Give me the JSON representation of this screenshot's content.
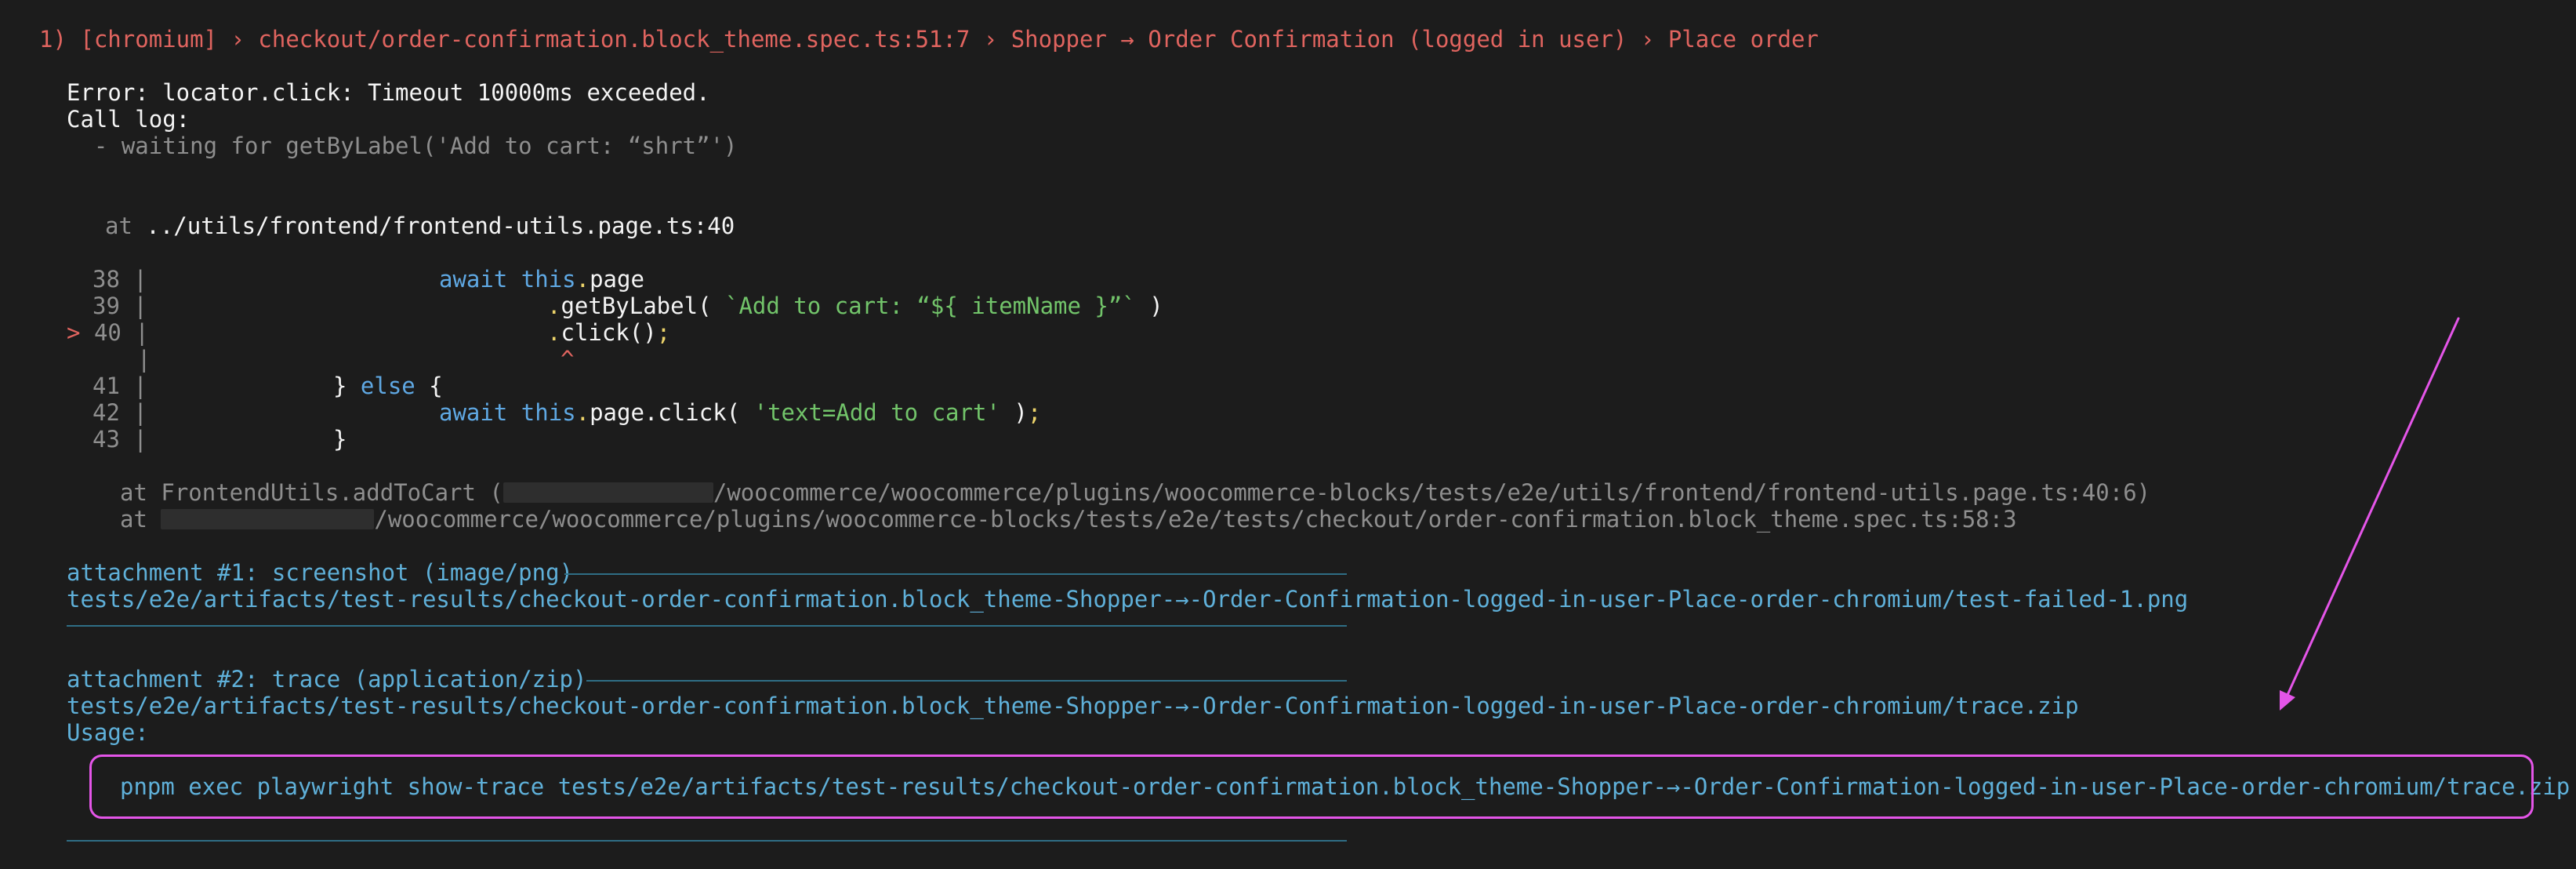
{
  "header": {
    "number": "1)",
    "project": "[chromium]",
    "sep1": "›",
    "file": "checkout/order-confirmation.block_theme.spec.ts:51:7",
    "sep2": "›",
    "suite": "Shopper → Order Confirmation (logged in user)",
    "sep3": "›",
    "test": "Place order"
  },
  "error": {
    "message": "Error: locator.click: Timeout 10000ms exceeded.",
    "call_log_label": "Call log:",
    "call_log_entry": "  - waiting for getByLabel('Add to cart: “shrt”')"
  },
  "location": {
    "prefix": "at ",
    "path": "../utils/frontend/frontend-utils.page.ts:40"
  },
  "code": {
    "marker": ">",
    "lines": [
      {
        "num": "38",
        "pipe": "|"
      },
      {
        "num": "39",
        "pipe": "|"
      },
      {
        "num": "40",
        "pipe": "|"
      },
      {
        "num": "",
        "pipe": "|"
      },
      {
        "num": "41",
        "pipe": "|"
      },
      {
        "num": "42",
        "pipe": "|"
      },
      {
        "num": "43",
        "pipe": "|"
      }
    ],
    "await": "await",
    "this": "this",
    "dot": ".",
    "page": "page",
    "getByLabel": "getByLabel(",
    "template": "`Add to cart: “${ itemName }”`",
    "close_paren": " )",
    "click_call": "click()",
    "semicolon": ";",
    "caret": "^",
    "close_brace_else": "} ",
    "else": "else",
    "open_brace": " {",
    "page_click": "page.click( ",
    "text_arg": "'text=Add to cart'",
    "end_call": " );",
    "close_brace": "}"
  },
  "stack": {
    "line1_prefix": "at FrontendUtils.addToCart (",
    "line1_suffix": "/woocommerce/woocommerce/plugins/woocommerce-blocks/tests/e2e/utils/frontend/frontend-utils.page.ts:40:6)",
    "line2_prefix": "at ",
    "line2_suffix": "/woocommerce/woocommerce/plugins/woocommerce-blocks/tests/e2e/tests/checkout/order-confirmation.block_theme.spec.ts:58:3"
  },
  "attachment1": {
    "title": "attachment #1: screenshot (image/png) ",
    "path": "tests/e2e/artifacts/test-results/checkout-order-confirmation.block_theme-Shopper-→-Order-Confirmation-logged-in-user-Place-order-chromium/test-failed-1.png"
  },
  "attachment2": {
    "title": "attachment #2: trace (application/zip) ",
    "path": "tests/e2e/artifacts/test-results/checkout-order-confirmation.block_theme-Shopper-→-Order-Confirmation-logged-in-user-Place-order-chromium/trace.zip",
    "usage_label": "Usage:",
    "command": "pnpm exec playwright show-trace tests/e2e/artifacts/test-results/checkout-order-confirmation.block_theme-Shopper-→-Order-Confirmation-logged-in-user-Place-order-chromium/trace.zip"
  },
  "colors": {
    "annotation": "#e455e8",
    "error": "#e0645f",
    "attachment": "#5fb0d9"
  }
}
